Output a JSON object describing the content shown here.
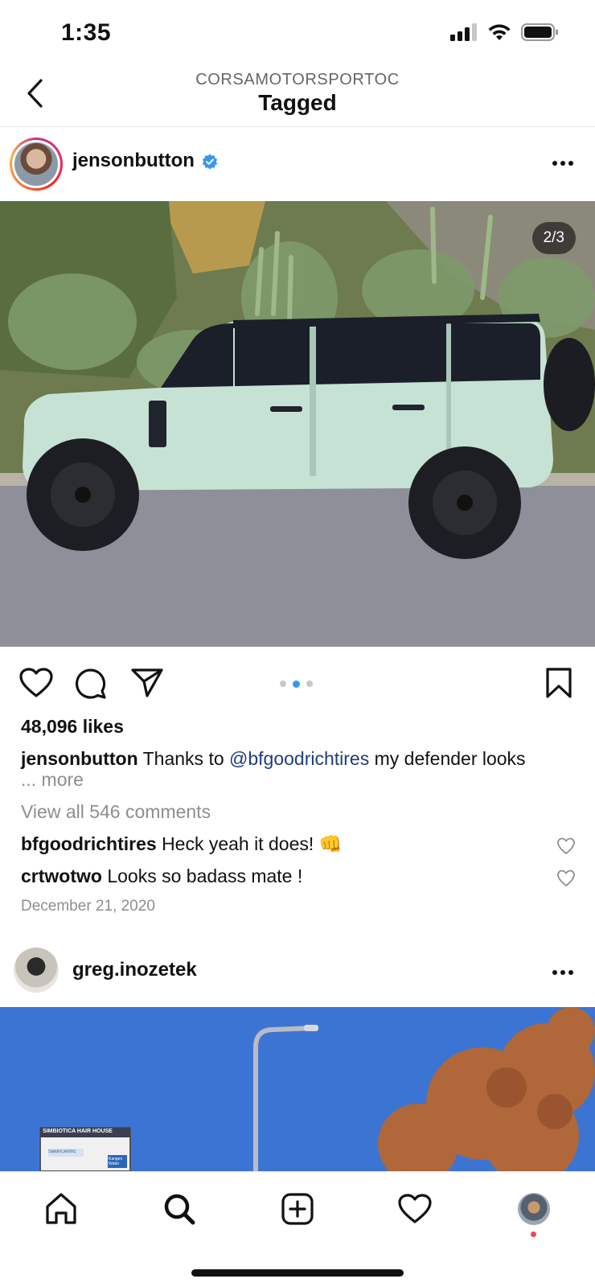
{
  "status_bar": {
    "time": "1:35"
  },
  "header": {
    "account": "CORSAMOTORSPORTOC",
    "title": "Tagged"
  },
  "post": {
    "username": "jensonbutton",
    "verified": true,
    "image_counter": "2/3",
    "carousel": {
      "count": 3,
      "active": 2
    },
    "likes": "48,096 likes",
    "caption_username": "jensonbutton",
    "caption_prefix": "Thanks to",
    "caption_mention": "@bfgoodrichtires",
    "caption_suffix": "my defender looks",
    "more_label": "... more",
    "view_all_comments": "View all 546 comments",
    "comments": [
      {
        "username": "bfgoodrichtires",
        "text": "Heck yeah it does! 👊"
      },
      {
        "username": "crtwotwo",
        "text": "Looks so badass mate !"
      }
    ],
    "date": "December 21, 2020"
  },
  "post2": {
    "username": "greg.inozetek",
    "sign_text_1": "SIMBIOTICA HAIR HOUSE",
    "sign_text_2": "SalonCentric",
    "sign_text_3": "Kangen Water"
  },
  "icons": {
    "back": "chevron-left-icon",
    "like": "heart-icon",
    "comment": "comment-bubble-icon",
    "share": "paper-plane-icon",
    "save": "bookmark-icon",
    "home": "home-icon",
    "search": "search-icon",
    "create": "plus-square-icon",
    "activity": "heart-icon",
    "profile": "profile-avatar"
  },
  "colors": {
    "verified_blue": "#3897f0",
    "mention": "#1f3d7a",
    "muted": "#8e8e8e",
    "notification_dot": "#ed4956"
  }
}
